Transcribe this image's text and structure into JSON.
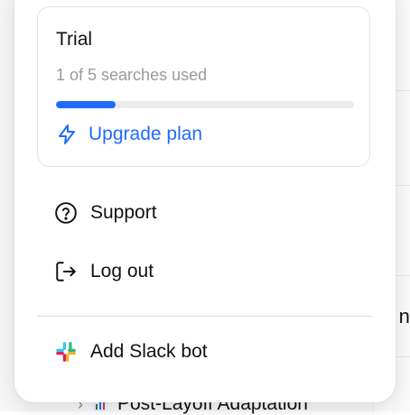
{
  "plan": {
    "title": "Trial",
    "usage_text": "1 of 5 searches used",
    "searches_used": 1,
    "searches_total": 5,
    "upgrade_label": "Upgrade plan",
    "accent_color": "#1f6bff"
  },
  "menu": {
    "support_label": "Support",
    "logout_label": "Log out",
    "slack_label": "Add Slack bot"
  },
  "background": {
    "partial_text": "nt",
    "row_label": "Post-Layoff Adaptation"
  },
  "icons": {
    "upgrade": "lightning-bolt-icon",
    "support": "question-circle-icon",
    "logout": "logout-icon",
    "slack": "slack-logo-icon",
    "row_chevron": "chevron-right-icon",
    "row_icon": "bar-chart-icon"
  }
}
